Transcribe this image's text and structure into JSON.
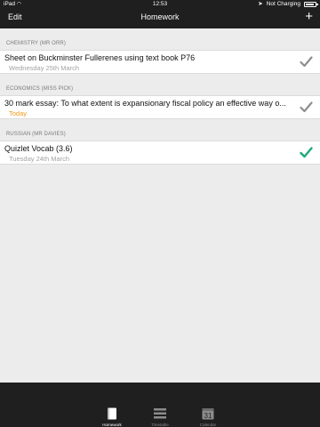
{
  "status_bar": {
    "device": "iPad",
    "time": "12:53",
    "charging": "Not Charging",
    "battery_level": 0.85
  },
  "nav": {
    "edit_label": "Edit",
    "title": "Homework",
    "add_label": "+"
  },
  "sections": [
    {
      "header": "CHEMISTRY (MR ORR)",
      "item": {
        "title": "Sheet on Buckminster Fullerenes using text book P76",
        "due": "Wednesday 25th March",
        "completed": false
      }
    },
    {
      "header": "ECONOMICS (MISS PICK)",
      "item": {
        "title": "30 mark essay: To what extent is expansionary fiscal policy an effective way o...",
        "due": "Today",
        "completed": false
      }
    },
    {
      "header": "RUSSIAN (MR DAVIES)",
      "item": {
        "title": "Quizlet Vocab (3.6)",
        "due": "Tuesday 24th March",
        "completed": true
      }
    }
  ],
  "tabs": [
    {
      "label": "Homework",
      "icon": "book-icon",
      "active": true
    },
    {
      "label": "Timetable",
      "icon": "list-icon",
      "active": false
    },
    {
      "label": "Calendar",
      "icon": "calendar-icon",
      "active": false,
      "calendar_day": "31"
    }
  ],
  "colors": {
    "bar_background": "#1f1f1f",
    "page_background": "#ececec",
    "check_pending": "#8e8e8e",
    "check_done": "#1fa87a",
    "today_text": "#f29a1a"
  }
}
